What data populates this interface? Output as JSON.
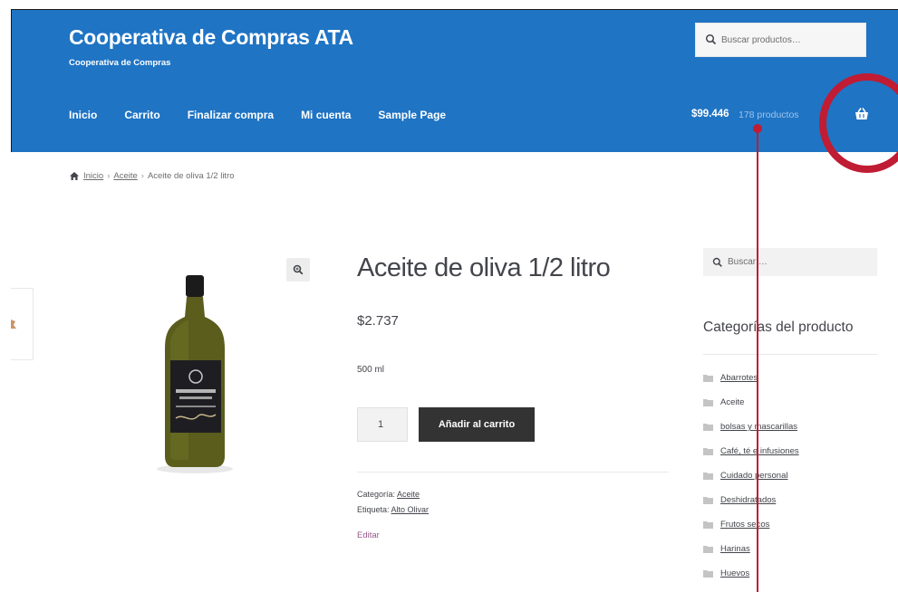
{
  "header": {
    "site_title": "Cooperativa de Compras ATA",
    "site_description": "Cooperativa de Compras",
    "search_placeholder": "Buscar productos…",
    "nav": [
      "Inicio",
      "Carrito",
      "Finalizar compra",
      "Mi cuenta",
      "Sample Page"
    ],
    "cart_total": "$99.446",
    "cart_count": "178 productos",
    "colors": {
      "header_bg": "#1f74c4",
      "annotation": "#c01c33"
    },
    "icons": {
      "search": "search-icon",
      "cart": "basket-icon"
    }
  },
  "breadcrumb": {
    "home": "Inicio",
    "category": "Aceite",
    "current": "Aceite de oliva 1/2 litro",
    "home_icon": "home-icon"
  },
  "product": {
    "title": "Aceite de oliva 1/2 litro",
    "price": "$2.737",
    "short_description": "500 ml",
    "quantity": "1",
    "add_to_cart": "Añadir al carrito",
    "category_label": "Categoría:",
    "category": "Aceite",
    "tag_label": "Etiqueta:",
    "tag": "Alto Olivar",
    "edit": "Editar",
    "zoom_icon": "zoom-icon"
  },
  "sidebar": {
    "search_placeholder": "Buscar …",
    "widget_title": "Categorías del producto",
    "categories": [
      "Abarrotes",
      "Aceite",
      "bolsas y mascarillas",
      "Café, té e infusiones",
      "Cuidado personal",
      "Deshidratados",
      "Frutos secos",
      "Harinas",
      "Huevos"
    ]
  }
}
